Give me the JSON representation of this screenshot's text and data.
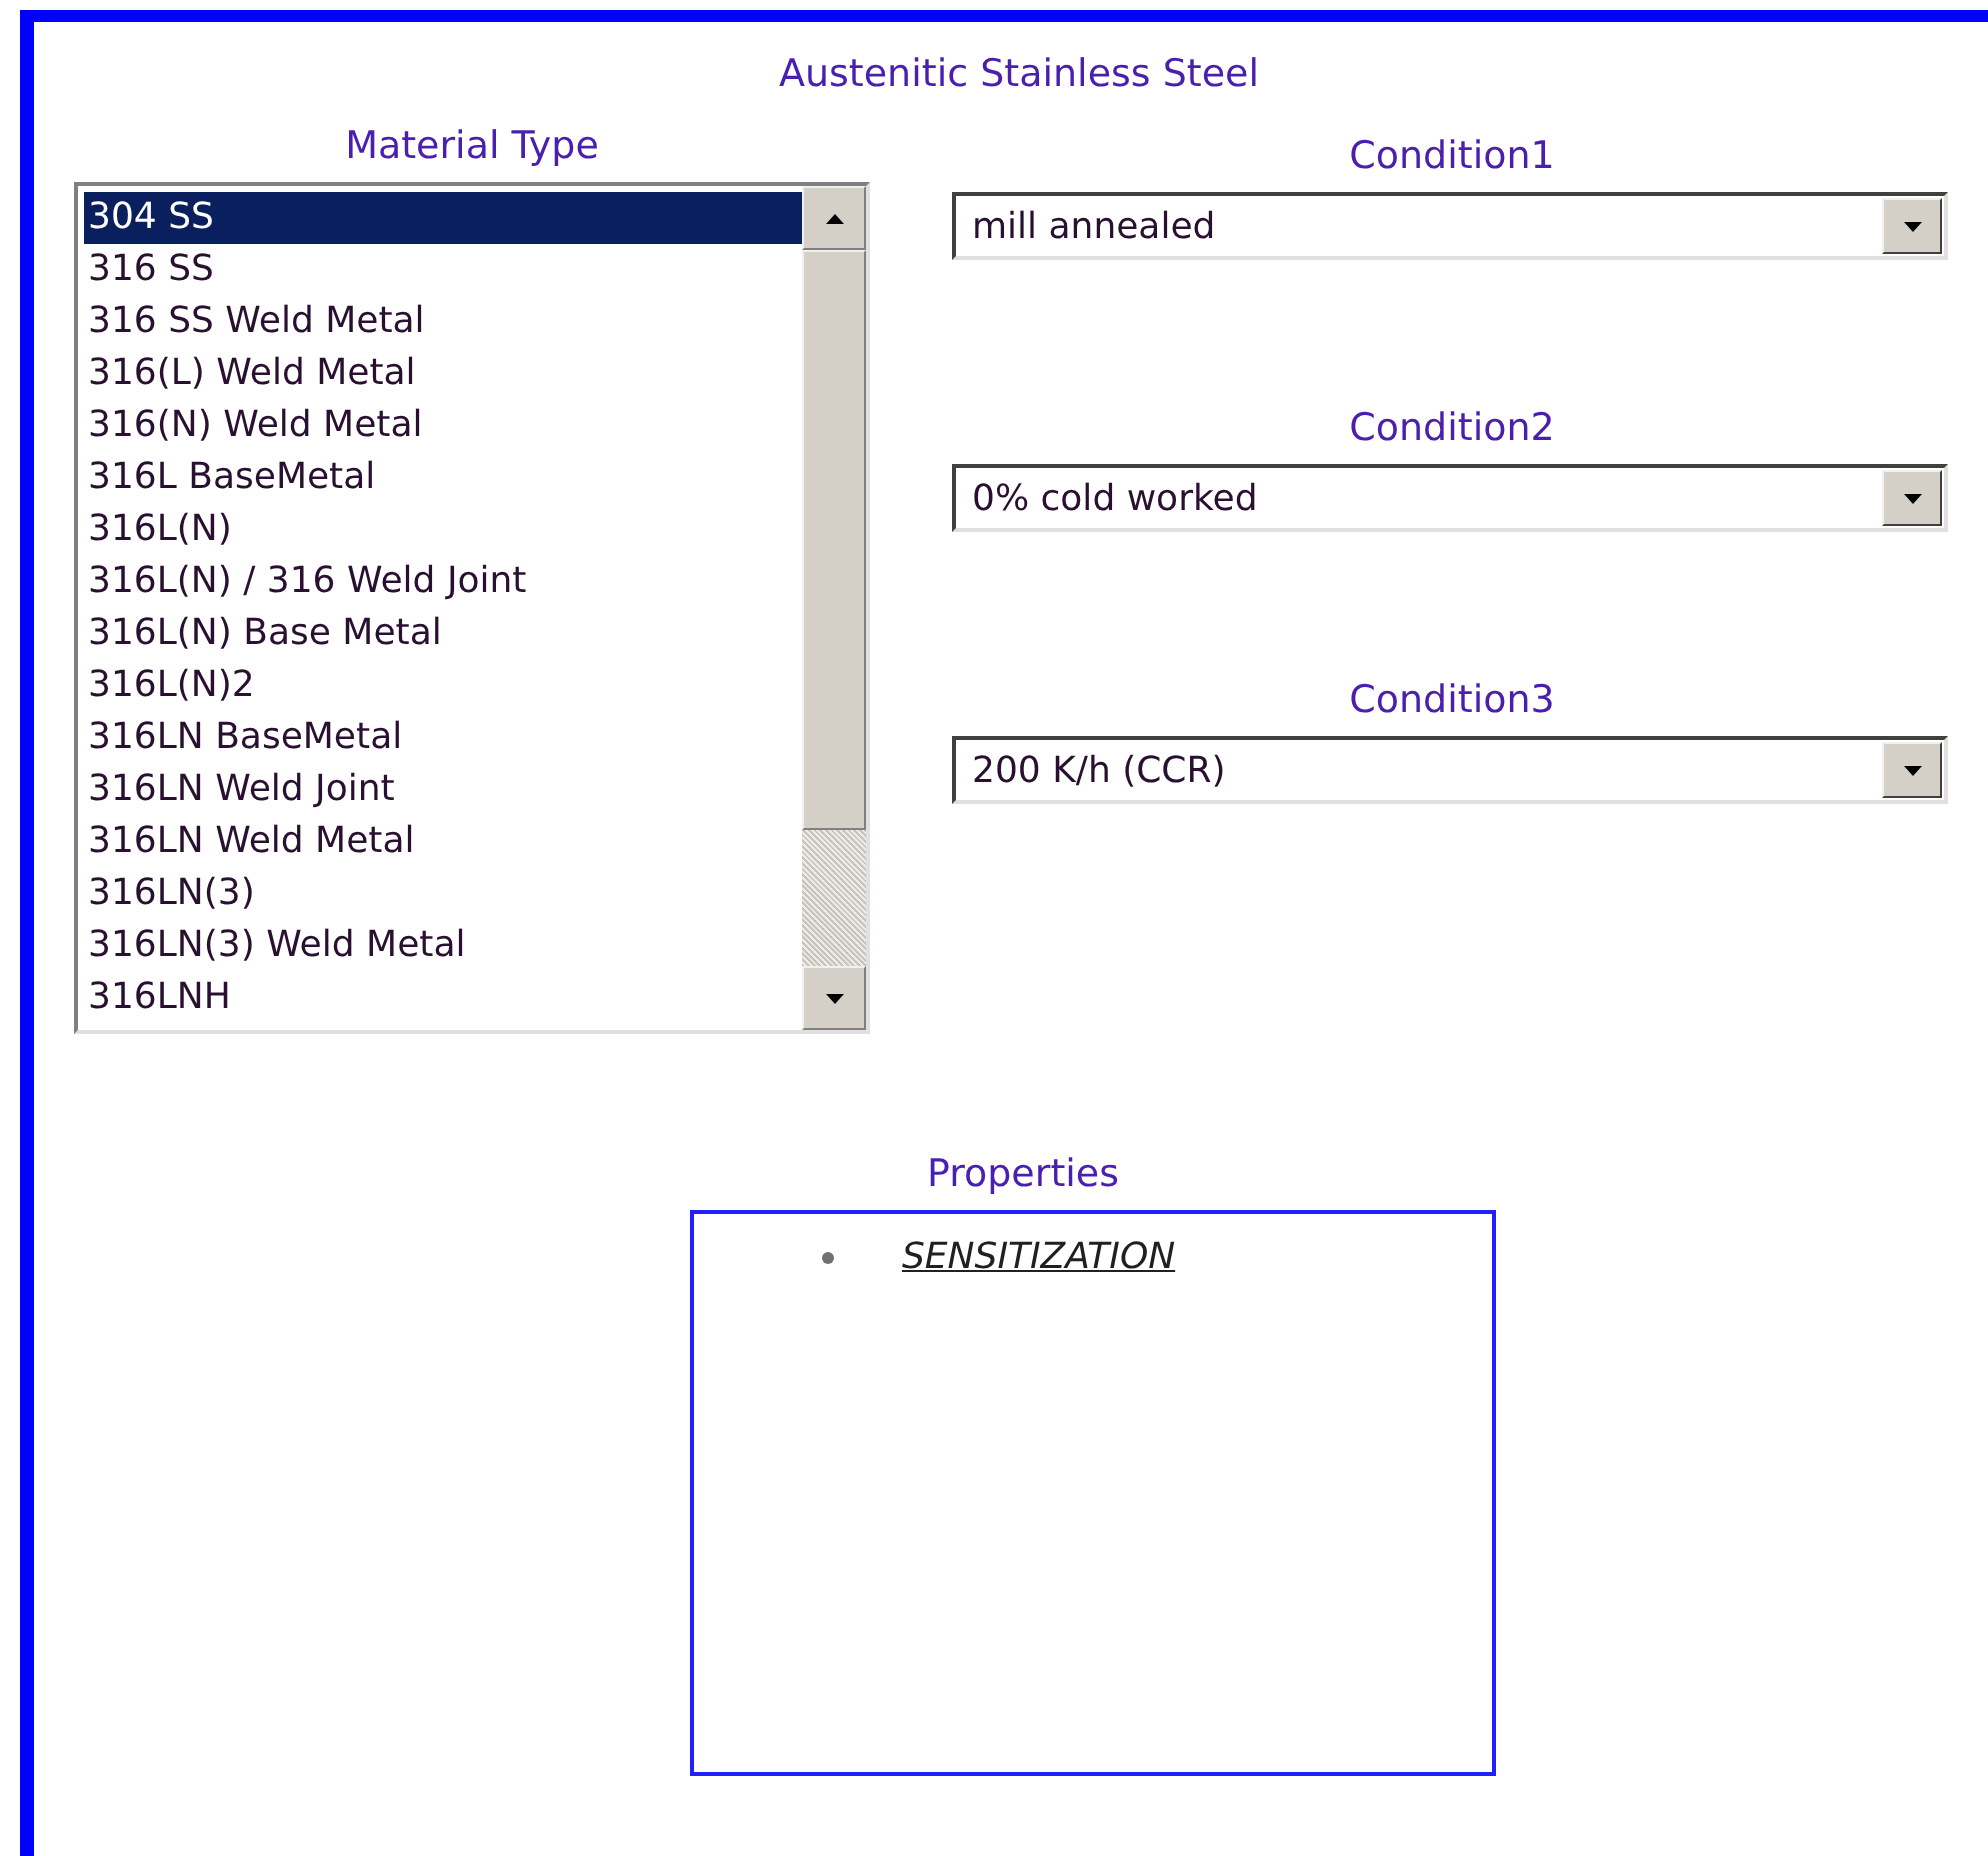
{
  "title": "Austenitic Stainless Steel",
  "material_type": {
    "label": "Material Type",
    "items": [
      {
        "label": "304 SS",
        "selected": true
      },
      {
        "label": "316 SS",
        "selected": false
      },
      {
        "label": "316 SS Weld Metal",
        "selected": false
      },
      {
        "label": "316(L) Weld Metal",
        "selected": false
      },
      {
        "label": "316(N) Weld Metal",
        "selected": false
      },
      {
        "label": "316L BaseMetal",
        "selected": false
      },
      {
        "label": "316L(N)",
        "selected": false
      },
      {
        "label": "316L(N) / 316 Weld Joint",
        "selected": false
      },
      {
        "label": "316L(N) Base Metal",
        "selected": false
      },
      {
        "label": "316L(N)2",
        "selected": false
      },
      {
        "label": "316LN BaseMetal",
        "selected": false
      },
      {
        "label": "316LN Weld Joint",
        "selected": false
      },
      {
        "label": "316LN Weld Metal",
        "selected": false
      },
      {
        "label": "316LN(3)",
        "selected": false
      },
      {
        "label": "316LN(3) Weld Metal",
        "selected": false
      },
      {
        "label": "316LNH",
        "selected": false
      }
    ]
  },
  "conditions": [
    {
      "label": "Condition1",
      "value": "mill annealed"
    },
    {
      "label": "Condition2",
      "value": "0% cold worked"
    },
    {
      "label": "Condition3",
      "value": "200 K/h (CCR)"
    }
  ],
  "properties": {
    "label": "Properties",
    "items": [
      "SENSITIZATION"
    ]
  }
}
